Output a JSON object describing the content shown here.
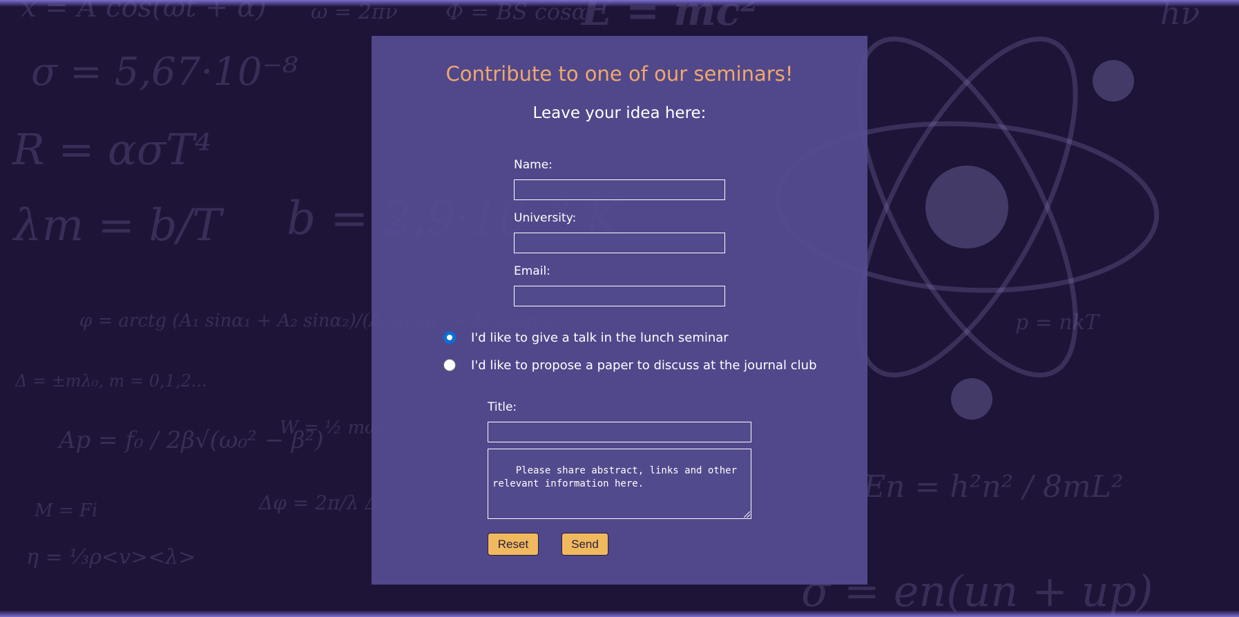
{
  "colors": {
    "page_background": "#1e1438",
    "panel_background": "#544c91",
    "heading_accent": "#f0a86c",
    "button_fill": "#f0b95e",
    "radio_checked": "#0b6fd9"
  },
  "background": {
    "decoration_icon": "atom-icon",
    "formulas": [
      "x = A cos(ωt + α)",
      "ω = 2πν",
      "Φ = BS cosα",
      "E = mc²",
      "hν",
      "σ = 5,67·10⁻⁸",
      "R = ασT⁴",
      "λm = b/T",
      "b = 2,9·10⁻³ K",
      "φ = arctg (A₁ sinα₁ + A₂ sinα₂)/(A₁ cosα₁ + A₂ cosα₂)",
      "Δ = ±mλ₀, m = 0,1,2...",
      "Ap = f₀ / 2β√(ω₀² − β²)",
      "W = ½ mω²",
      "M = Fi",
      "Δφ = 2π/λ Δx",
      "η = ⅓ρ<v><λ>",
      "p = nkT",
      "En = h²n² / 8mL²",
      "σ = en(un + up)"
    ]
  },
  "form": {
    "title": "Contribute to one of our seminars!",
    "subtitle": "Leave your idea here:",
    "name_label": "Name:",
    "name_value": "",
    "university_label": "University:",
    "university_value": "",
    "email_label": "Email:",
    "email_value": "",
    "options": [
      {
        "label": "I'd like to give a talk in the lunch seminar",
        "checked": true
      },
      {
        "label": "I'd like to propose a paper to discuss at the journal club",
        "checked": false
      }
    ],
    "title_label": "Title:",
    "title_value": "",
    "description_placeholder": "Please share abstract, links and other relevant information here.",
    "reset_label": "Reset",
    "send_label": "Send"
  }
}
